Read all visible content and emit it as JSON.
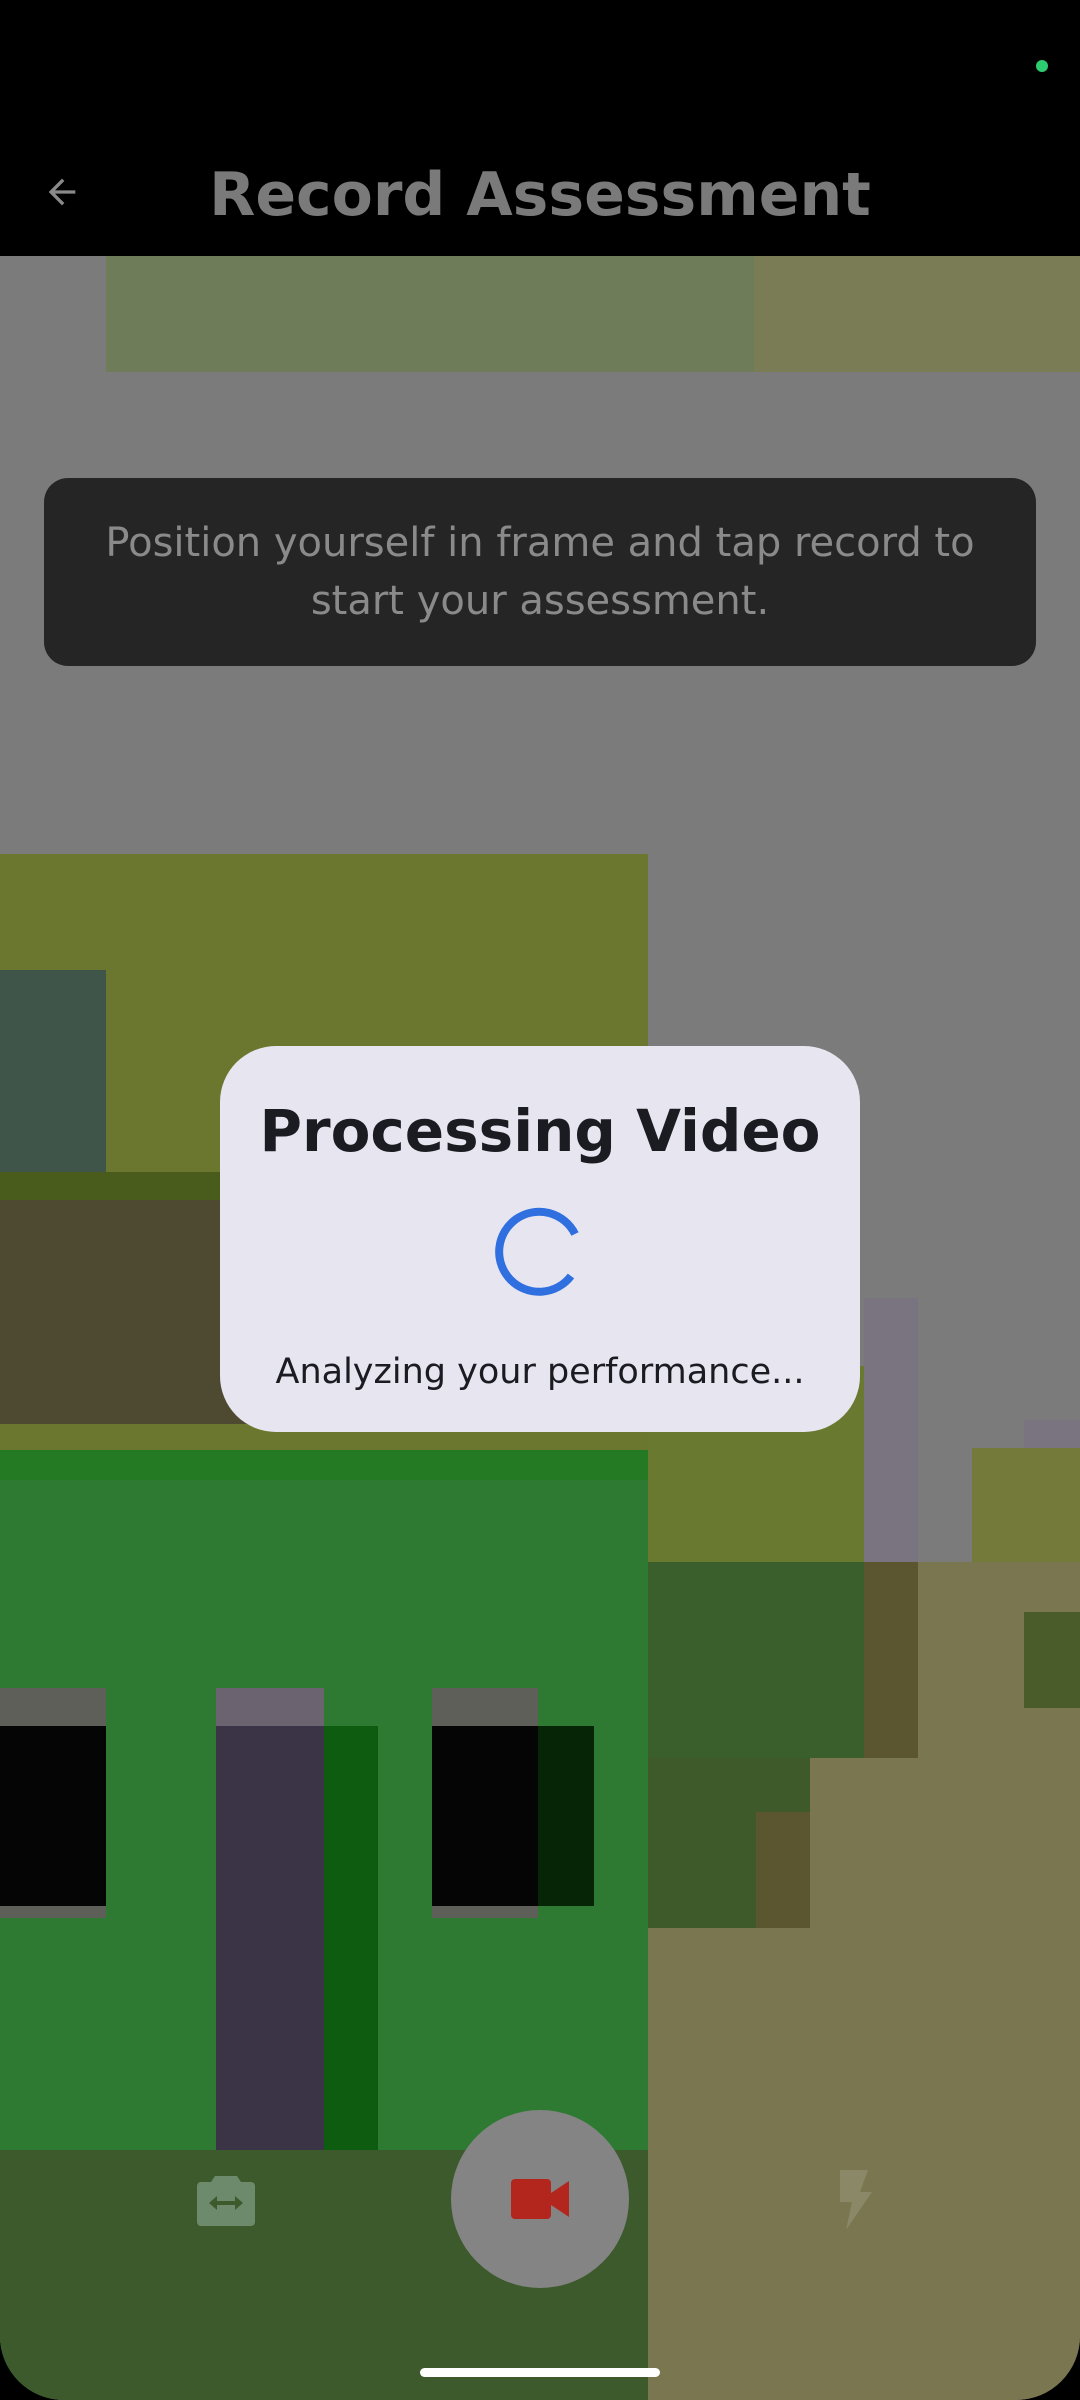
{
  "status": {
    "indicator_color": "#2ecc71"
  },
  "app_bar": {
    "title": "Record Assessment",
    "back_icon": "arrow-left-icon"
  },
  "hint": {
    "text": "Position yourself in frame and tap record to start your assessment."
  },
  "dialog": {
    "title": "Processing Video",
    "subtitle": "Analyzing your performance...",
    "spinner_color": "#2f6fe0"
  },
  "controls": {
    "switch_camera_icon": "switch-camera-icon",
    "record_icon": "video-camera-icon",
    "record_color": "#b3261e",
    "flash_icon": "flash-icon"
  }
}
